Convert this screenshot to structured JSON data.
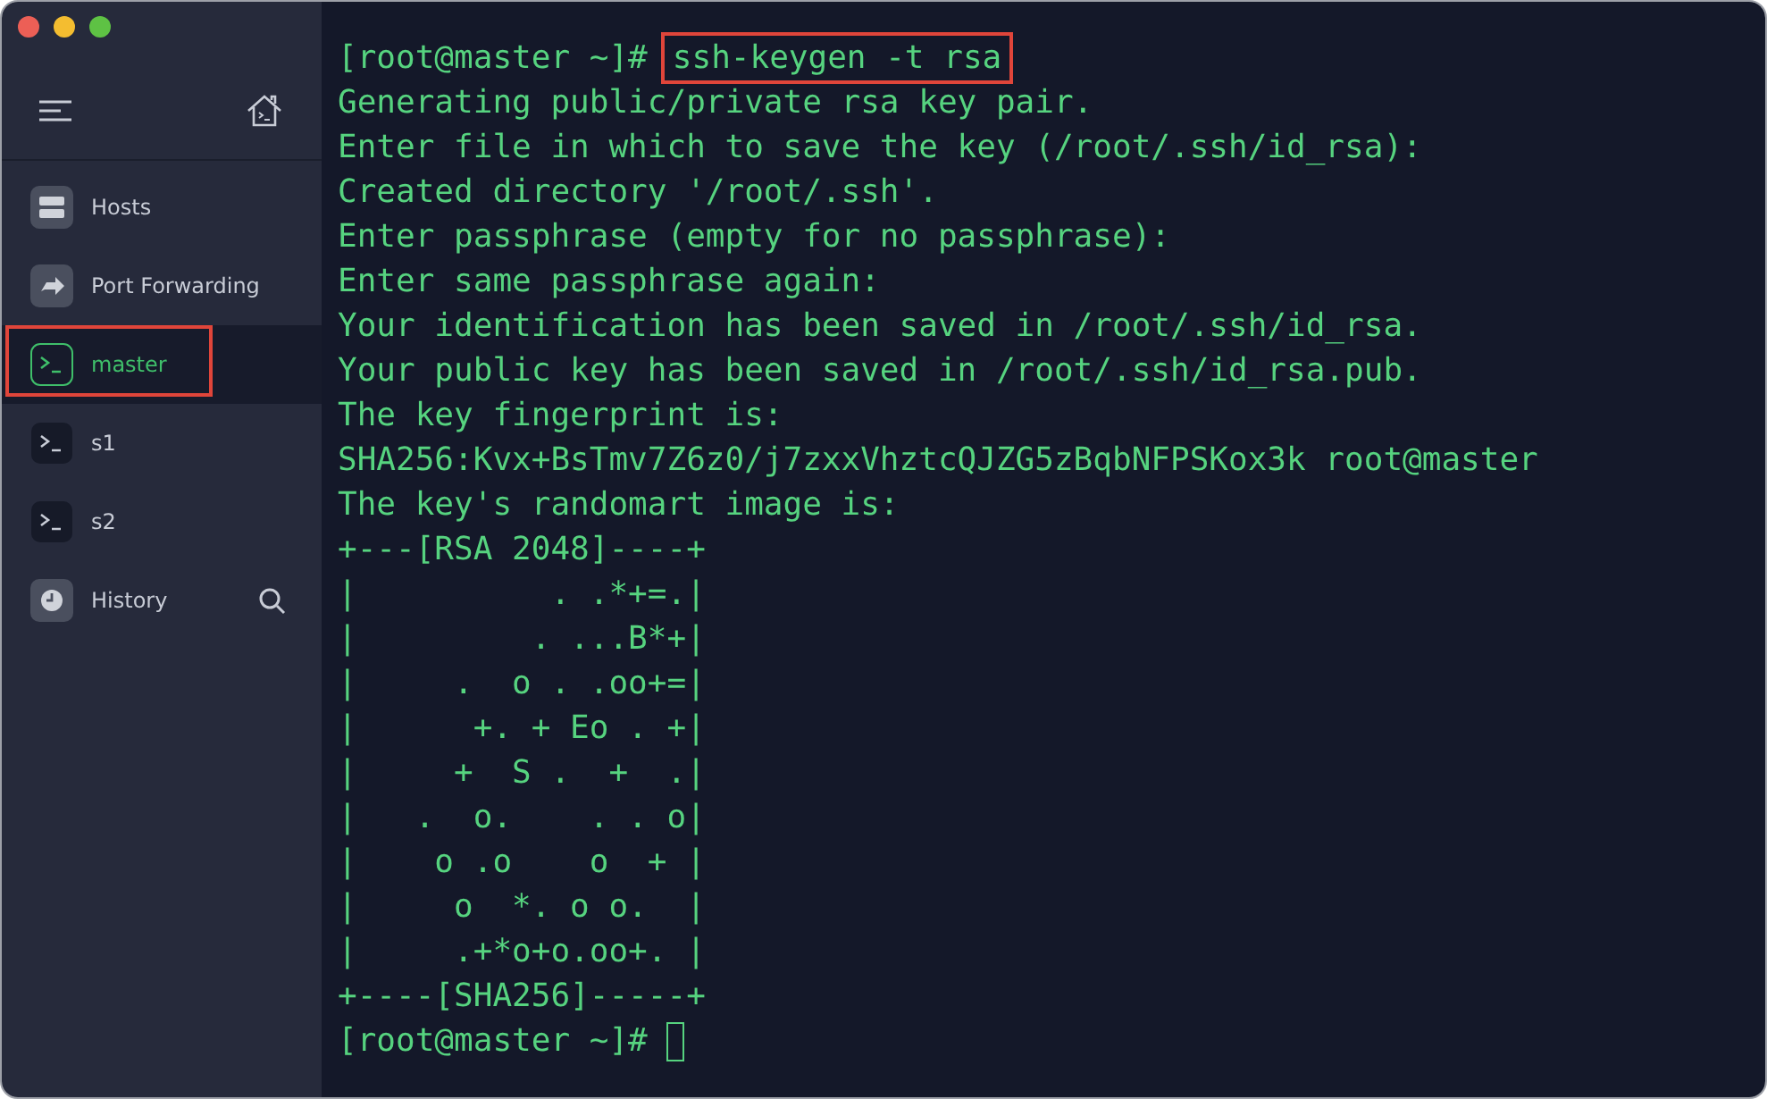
{
  "sidebar": {
    "items": [
      {
        "label": "Hosts",
        "kind": "hosts",
        "selected": false,
        "highlighted": false
      },
      {
        "label": "Port Forwarding",
        "kind": "forward",
        "selected": false,
        "highlighted": false
      },
      {
        "label": "master",
        "kind": "terminal",
        "selected": true,
        "highlighted": true
      },
      {
        "label": "s1",
        "kind": "terminal",
        "selected": false,
        "highlighted": false
      },
      {
        "label": "s2",
        "kind": "terminal",
        "selected": false,
        "highlighted": false
      },
      {
        "label": "History",
        "kind": "history",
        "selected": false,
        "highlighted": false
      }
    ]
  },
  "terminal": {
    "lines": [
      {
        "kind": "prompt",
        "prompt": "[root@master ~]#",
        "command": "ssh-keygen -t rsa",
        "highlighted": true
      },
      {
        "kind": "output",
        "text": "Generating public/private rsa key pair."
      },
      {
        "kind": "output",
        "text": "Enter file in which to save the key (/root/.ssh/id_rsa):"
      },
      {
        "kind": "output",
        "text": "Created directory '/root/.ssh'."
      },
      {
        "kind": "output",
        "text": "Enter passphrase (empty for no passphrase):"
      },
      {
        "kind": "output",
        "text": "Enter same passphrase again:"
      },
      {
        "kind": "output",
        "text": "Your identification has been saved in /root/.ssh/id_rsa."
      },
      {
        "kind": "output",
        "text": "Your public key has been saved in /root/.ssh/id_rsa.pub."
      },
      {
        "kind": "output",
        "text": "The key fingerprint is:"
      },
      {
        "kind": "output",
        "text": "SHA256:Kvx+BsTmv7Z6z0/j7zxxVhztcQJZG5zBqbNFPSKox3k root@master"
      },
      {
        "kind": "output",
        "text": "The key's randomart image is:"
      },
      {
        "kind": "output",
        "text": "+---[RSA 2048]----+"
      },
      {
        "kind": "output",
        "text": "|          . .*+=.|"
      },
      {
        "kind": "output",
        "text": "|         . ...B*+|"
      },
      {
        "kind": "output",
        "text": "|     .  o . .oo+=|"
      },
      {
        "kind": "output",
        "text": "|      +. + Eo . +|"
      },
      {
        "kind": "output",
        "text": "|     +  S .  +  .|"
      },
      {
        "kind": "output",
        "text": "|   .  o.    . . o|"
      },
      {
        "kind": "output",
        "text": "|    o .o    o  + |"
      },
      {
        "kind": "output",
        "text": "|     o  *. o o.  |"
      },
      {
        "kind": "output",
        "text": "|     .+*o+o.oo+. |"
      },
      {
        "kind": "output",
        "text": "+----[SHA256]-----+"
      },
      {
        "kind": "input",
        "prompt": "[root@master ~]#"
      }
    ]
  }
}
